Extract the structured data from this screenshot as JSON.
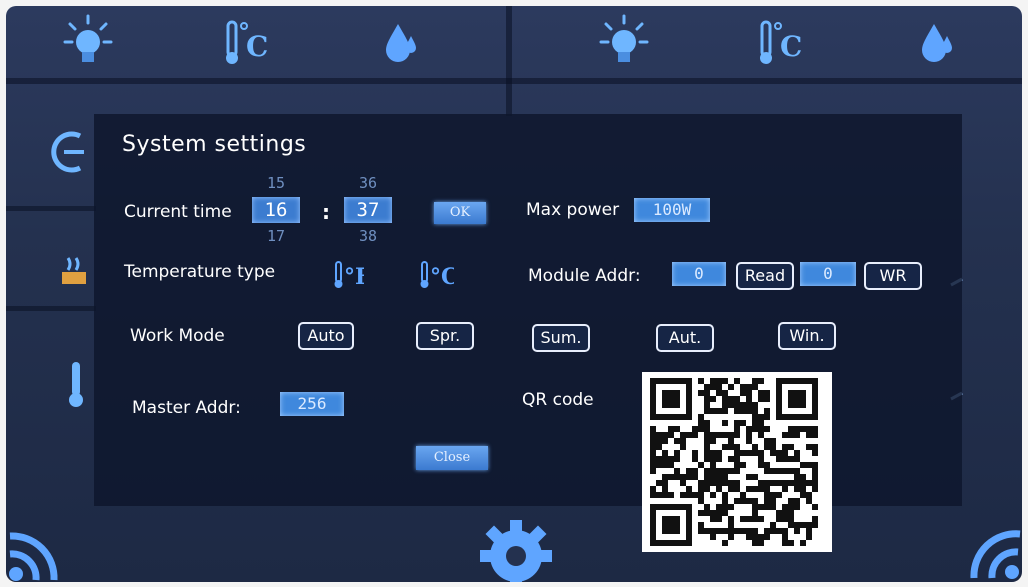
{
  "background_icons": {
    "top": [
      "lightbulb-icon",
      "thermometer-celsius-icon",
      "water-drop-icon",
      "lightbulb-icon",
      "thermometer-celsius-icon",
      "water-drop-icon"
    ],
    "left": [
      "arrow-left-icon",
      "heater-icon",
      "thermometer-icon"
    ],
    "bottom": [
      "wifi-icon",
      "settings-gear-icon",
      "wifi-icon"
    ]
  },
  "dialog": {
    "title": "System  settings",
    "current_time": {
      "label": "Current time",
      "hour_prev": "15",
      "hour": "16",
      "hour_next": "17",
      "separator": ":",
      "minute_prev": "36",
      "minute": "37",
      "minute_next": "38",
      "ok_label": "OK"
    },
    "max_power": {
      "label": "Max power",
      "value": "100W"
    },
    "temperature_type": {
      "label": "Temperature type",
      "fahrenheit": "°F",
      "celsius": "°C"
    },
    "module_addr": {
      "label": "Module Addr:",
      "read_value": "0",
      "read_label": "Read",
      "write_value": "0",
      "write_label": "WR"
    },
    "work_mode": {
      "label": "Work Mode",
      "options": [
        "Auto",
        "Spr.",
        "Sum.",
        "Aut.",
        "Win."
      ]
    },
    "master_addr": {
      "label": "Master Addr:",
      "value": "256"
    },
    "qr": {
      "label": "QR code"
    },
    "close_label": "Close"
  },
  "colors": {
    "accent": "#3f88dd",
    "icon": "#5fa5ff",
    "dialog_bg": "#0e162c"
  }
}
